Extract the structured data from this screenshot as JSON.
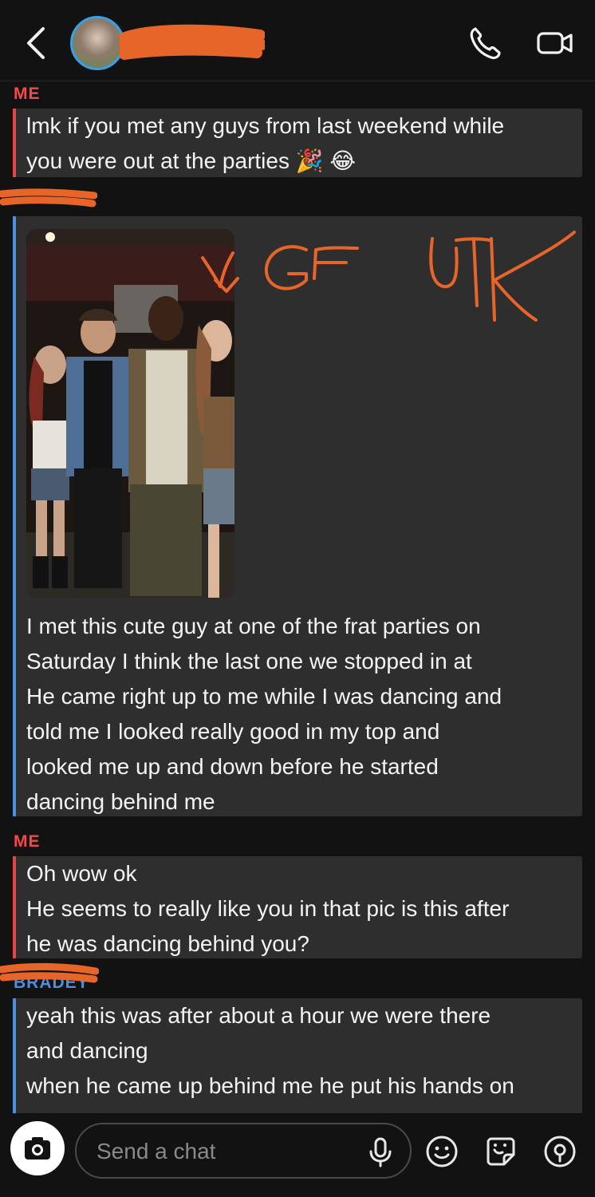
{
  "header": {
    "back_icon": "chevron-left-icon",
    "call_icon": "phone-icon",
    "video_icon": "video-camera-icon"
  },
  "messages": [
    {
      "sender_label": "ME",
      "lines": [
        "lmk if you met any guys from last weekend while",
        "you were out at the parties 🎉 😂"
      ]
    },
    {
      "sender_label": "",
      "photo": true,
      "annotation": "↓ GF UTK",
      "lines": [
        "I met this cute guy at one of the frat parties on",
        "Saturday I think the last one we stopped in at",
        "He came right up to me while I was dancing and",
        "told me I looked really good in my top and",
        "looked me up and down before he started",
        "dancing behind me"
      ]
    },
    {
      "sender_label": "ME",
      "lines": [
        "Oh wow ok",
        "He seems to really like you in that pic is this after",
        "he was dancing behind you?"
      ]
    },
    {
      "sender_label": "BRADEY",
      "lines": [
        "yeah this was after about a hour we were there",
        "and dancing",
        "when he came up behind me he put his hands on"
      ]
    }
  ],
  "composer": {
    "placeholder": "Send a chat",
    "icons": [
      "camera-icon",
      "microphone-icon",
      "emoji-icon",
      "sticker-icon",
      "location-pin-icon"
    ]
  },
  "colors": {
    "background": "#121212",
    "bubble": "#2e2e2e",
    "me_accent": "#e24646",
    "friend_accent": "#4a8fe0",
    "redaction": "#e8652a"
  }
}
